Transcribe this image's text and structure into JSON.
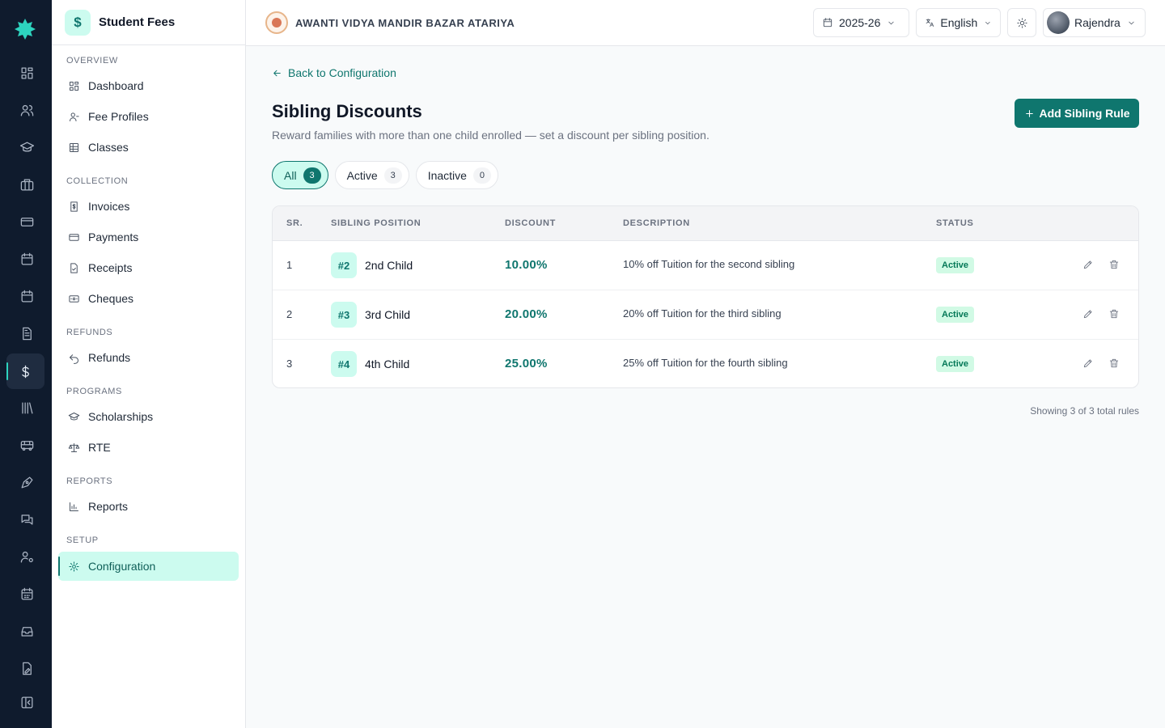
{
  "app": {
    "module_title": "Student Fees",
    "module_icon": "$",
    "school_name": "AWANTI VIDYA MANDIR BAZAR ATARIYA",
    "accent": "#0f766e"
  },
  "rail": {
    "items": [
      "dashboard-icon",
      "users-icon",
      "graduation-icon",
      "briefcase-icon",
      "card-icon",
      "calendar-icon",
      "calendar-icon",
      "document-icon",
      "dollar-icon",
      "library-icon",
      "bus-icon",
      "pen-icon",
      "chat-icon",
      "user-settings-icon",
      "calendar-grid-icon",
      "inbox-icon",
      "file-edit-icon",
      "collapse-icon"
    ]
  },
  "sidebar": {
    "sections": {
      "overview": "OVERVIEW",
      "collection": "COLLECTION",
      "refunds": "REFUNDS",
      "programs": "PROGRAMS",
      "reports": "REPORTS",
      "setup": "SETUP"
    },
    "items": {
      "dashboard": "Dashboard",
      "fee_profiles": "Fee Profiles",
      "classes": "Classes",
      "invoices": "Invoices",
      "payments": "Payments",
      "receipts": "Receipts",
      "cheques": "Cheques",
      "refunds": "Refunds",
      "scholarships": "Scholarships",
      "rte": "RTE",
      "reports": "Reports",
      "configuration": "Configuration"
    }
  },
  "topbar": {
    "year": "2025-26",
    "language": "English",
    "user": "Rajendra"
  },
  "page": {
    "back_link": "Back to Configuration",
    "title": "Sibling Discounts",
    "subtitle": "Reward families with more than one child enrolled — set a discount per sibling position.",
    "add_button": "Add Sibling Rule",
    "filters": [
      {
        "label": "All",
        "count": "3"
      },
      {
        "label": "Active",
        "count": "3"
      },
      {
        "label": "Inactive",
        "count": "0"
      }
    ],
    "columns": {
      "sr": "SR.",
      "position": "SIBLING POSITION",
      "discount": "DISCOUNT",
      "description": "DESCRIPTION",
      "status": "STATUS"
    },
    "rows": [
      {
        "sr": "1",
        "badge": "#2",
        "position": "2nd Child",
        "discount": "10.00%",
        "description": "10% off Tuition for the second sibling",
        "status": "Active"
      },
      {
        "sr": "2",
        "badge": "#3",
        "position": "3rd Child",
        "discount": "20.00%",
        "description": "20% off Tuition for the third sibling",
        "status": "Active"
      },
      {
        "sr": "3",
        "badge": "#4",
        "position": "4th Child",
        "discount": "25.00%",
        "description": "25% off Tuition for the fourth sibling",
        "status": "Active"
      }
    ],
    "footer": "Showing 3 of 3 total rules"
  }
}
